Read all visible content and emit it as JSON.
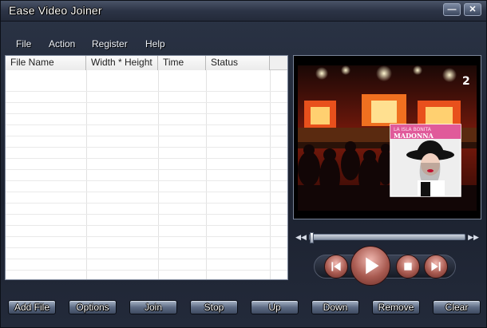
{
  "window": {
    "title": "Ease Video Joiner",
    "minimize_label": "—",
    "close_label": "✕"
  },
  "menu": [
    "File",
    "Action",
    "Register",
    "Help"
  ],
  "file_list": {
    "columns": [
      "File Name",
      "Width * Height",
      "Time",
      "Status"
    ],
    "rows": []
  },
  "video": {
    "channel_logo": "2",
    "album_title": "LA ISLA BONITA",
    "album_artist": "MADONNA"
  },
  "seek": {
    "position": 0.0,
    "rewind_icon": "rewind-icon",
    "forward_icon": "fast-forward-icon"
  },
  "player": {
    "prev_icon": "previous-icon",
    "play_icon": "play-icon",
    "stop_icon": "stop-icon",
    "next_icon": "next-icon"
  },
  "toolbar": {
    "add_file": "Add File",
    "options": "Options",
    "join": "Join",
    "stop": "Stop",
    "up": "Up",
    "down": "Down",
    "remove": "Remove",
    "clear": "Clear"
  },
  "colors": {
    "accent": "#5f6d86",
    "player_button": "#a85a50"
  }
}
